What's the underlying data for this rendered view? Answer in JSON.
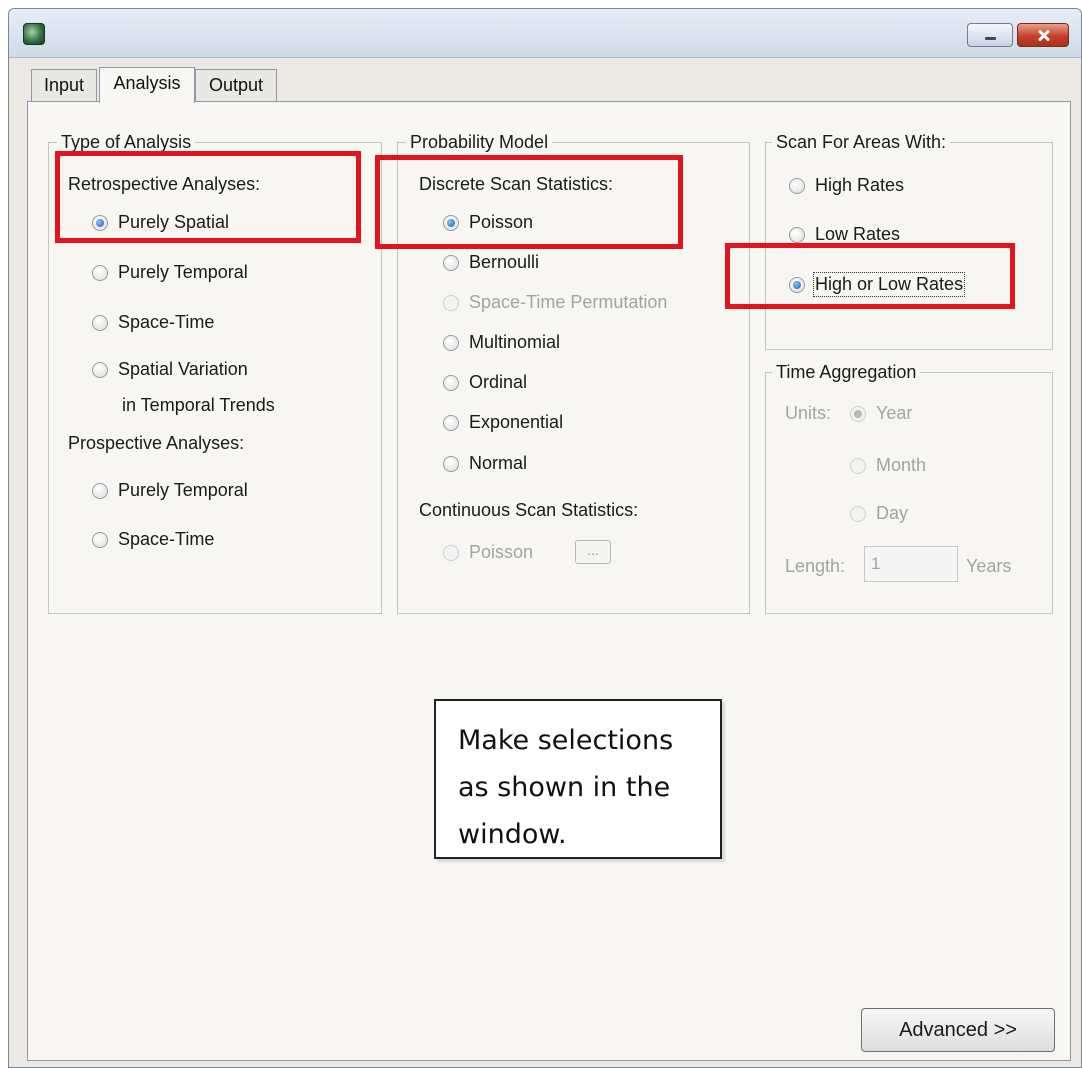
{
  "window": {
    "icon": "satscan-app-icon"
  },
  "tabs": [
    {
      "label": "Input",
      "active": false
    },
    {
      "label": "Analysis",
      "active": true
    },
    {
      "label": "Output",
      "active": false
    }
  ],
  "type_of_analysis": {
    "title": "Type of Analysis",
    "retrospective_label": "Retrospective Analyses:",
    "retrospective_options": [
      {
        "label": "Purely Spatial",
        "selected": true
      },
      {
        "label": "Purely Temporal",
        "selected": false
      },
      {
        "label": "Space-Time",
        "selected": false
      },
      {
        "label": "Spatial Variation",
        "label_line2": "in Temporal Trends",
        "selected": false
      }
    ],
    "prospective_label": "Prospective Analyses:",
    "prospective_options": [
      {
        "label": "Purely Temporal",
        "selected": false
      },
      {
        "label": "Space-Time",
        "selected": false
      }
    ]
  },
  "probability_model": {
    "title": "Probability Model",
    "discrete_label": "Discrete Scan Statistics:",
    "discrete_options": [
      {
        "label": "Poisson",
        "selected": true,
        "enabled": true
      },
      {
        "label": "Bernoulli",
        "selected": false,
        "enabled": true
      },
      {
        "label": "Space-Time Permutation",
        "selected": false,
        "enabled": false
      },
      {
        "label": "Multinomial",
        "selected": false,
        "enabled": true
      },
      {
        "label": "Ordinal",
        "selected": false,
        "enabled": true
      },
      {
        "label": "Exponential",
        "selected": false,
        "enabled": true
      },
      {
        "label": "Normal",
        "selected": false,
        "enabled": true
      }
    ],
    "continuous_label": "Continuous Scan Statistics:",
    "continuous_options": [
      {
        "label": "Poisson",
        "selected": false,
        "enabled": false
      }
    ],
    "ellipsis_button": "..."
  },
  "scan_for_areas": {
    "title": "Scan For Areas With:",
    "options": [
      {
        "label": "High Rates",
        "selected": false
      },
      {
        "label": "Low Rates",
        "selected": false
      },
      {
        "label": "High or Low Rates",
        "selected": true
      }
    ]
  },
  "time_aggregation": {
    "title": "Time Aggregation",
    "units_label": "Units:",
    "units_options": [
      {
        "label": "Year",
        "selected": true
      },
      {
        "label": "Month",
        "selected": false
      },
      {
        "label": "Day",
        "selected": false
      }
    ],
    "length_label": "Length:",
    "length_value": "1",
    "length_unit": "Years"
  },
  "note": "Make selections\nas shown in the\nwindow.",
  "advanced_button": "Advanced >>",
  "colors": {
    "highlight": "#e3141b",
    "selected_radio": "#1560b0"
  }
}
